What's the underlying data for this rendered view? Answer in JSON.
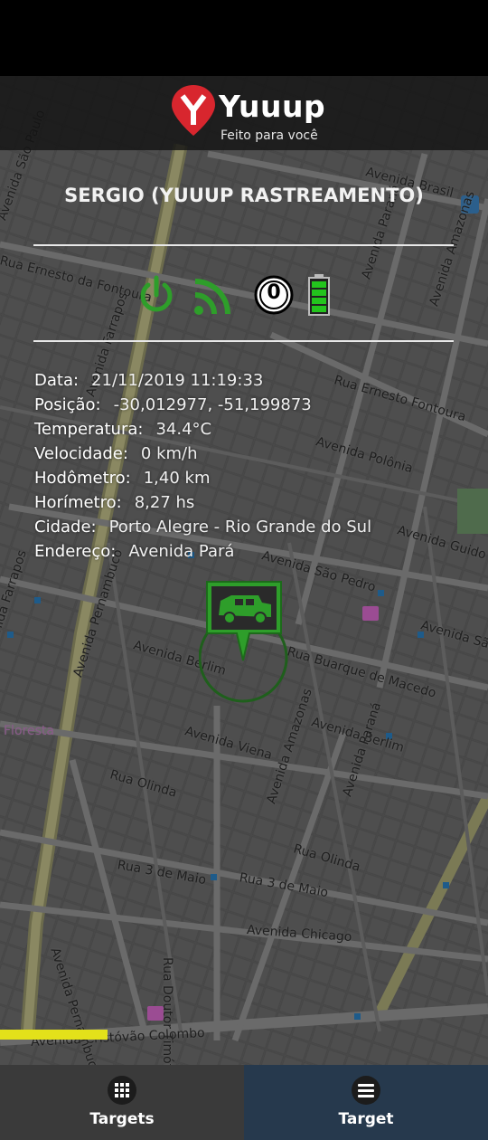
{
  "app": {
    "brand": "Yuuup",
    "tagline": "Feito para você"
  },
  "target": {
    "title": "SERGIO (YUUUP RASTREAMENTO)",
    "status_icons": [
      "ignition-power-icon",
      "signal-icon",
      "satellites-count-icon",
      "battery-icon"
    ],
    "satellites": "0",
    "colors": {
      "accent_green": "#2e9e2a",
      "battery_green": "#23c41d"
    }
  },
  "details": [
    {
      "label": "Data:",
      "value": "21/11/2019 11:19:33"
    },
    {
      "label": "Posição:",
      "value": "-30,012977, -51,199873"
    },
    {
      "label": "Temperatura:",
      "value": "34.4°C"
    },
    {
      "label": "Velocidade:",
      "value": "0 km/h"
    },
    {
      "label": "Hodômetro:",
      "value": "1,40 km"
    },
    {
      "label": "Horímetro:",
      "value": "8,27 hs"
    },
    {
      "label": "Cidade:",
      "value": "Porto Alegre - Rio Grande do Sul"
    },
    {
      "label": "Endereço:",
      "value": "Avenida Pará"
    }
  ],
  "map": {
    "streets": [
      "Avenida Brasil",
      "Avenida São Paulo",
      "Rua Ernesto da Fontoura",
      "Avenida Farrapos",
      "Avenida Paraná",
      "Rua Ernesto Fontoura",
      "Avenida Amazonas",
      "Avenida Polônia",
      "Avenida Guido Mondin",
      "Avenida São Pedro",
      "Avenida Pernambuco",
      "Avenida Berlim",
      "Rua Buarque de Macedo",
      "Avenida São",
      "Avenida Viena",
      "Rua Olinda",
      "Rua 3 de Maio",
      "Avenida Chicago",
      "Rua Doutor Timóteo",
      "Avenida Cristóvão Colombo",
      "Floresta",
      "Ave"
    ],
    "loading_progress": 0.22
  },
  "nav": {
    "targets_label": "Targets",
    "target_label": "Target"
  }
}
